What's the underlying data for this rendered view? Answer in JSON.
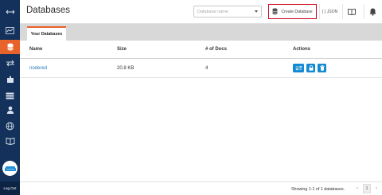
{
  "header": {
    "title": "Databases",
    "search_placeholder": "Database name",
    "create_label": "Create Database",
    "json_label": "{ } JSON"
  },
  "tabs": [
    {
      "label": "Your Databases",
      "active": true
    }
  ],
  "table": {
    "columns": [
      "Name",
      "Size",
      "# of Docs",
      "Actions"
    ],
    "rows": [
      {
        "name": "nodered",
        "size": "20.8 KB",
        "docs": "4"
      }
    ]
  },
  "sidebar": {
    "items": [
      "arrows-icon",
      "pulse-icon",
      "database-icon",
      "replication-icon",
      "puzzle-icon",
      "list-icon",
      "user-icon",
      "globe-icon",
      "book-icon"
    ],
    "active": "database-icon",
    "logout_label": "Log Out"
  },
  "footer": {
    "status": "Showing 1-1 of 1 databases.",
    "page": "1",
    "prev": "‹",
    "next": "›"
  },
  "colors": {
    "sidebar": "#13315a",
    "accent": "#e8622c",
    "highlight": "#d0021b",
    "action": "#1489d4",
    "link": "#2a7ab8"
  }
}
